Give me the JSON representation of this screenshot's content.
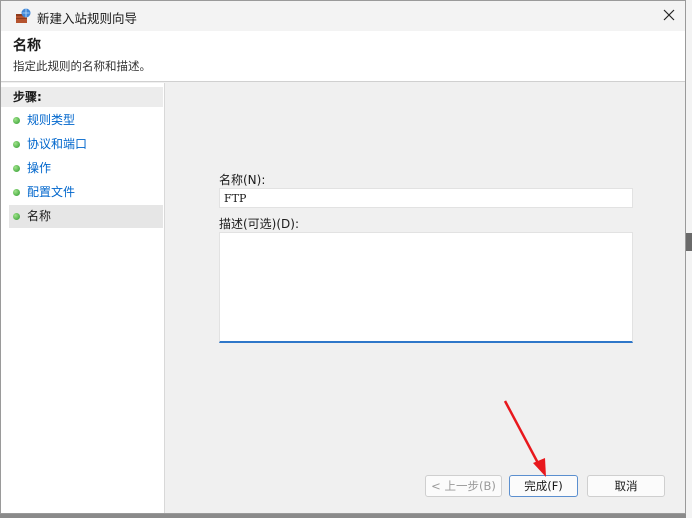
{
  "window": {
    "title": "新建入站规则向导",
    "close_label": "✕"
  },
  "header": {
    "title": "名称",
    "subtitle": "指定此规则的名称和描述。"
  },
  "steps": {
    "title": "步骤:",
    "items": [
      {
        "label": "规则类型"
      },
      {
        "label": "协议和端口"
      },
      {
        "label": "操作"
      },
      {
        "label": "配置文件"
      },
      {
        "label": "名称"
      }
    ]
  },
  "form": {
    "name_label": "名称(N):",
    "name_value": "FTP",
    "desc_label": "描述(可选)(D):",
    "desc_value": ""
  },
  "buttons": {
    "back": "< 上一步(B)",
    "finish": "完成(F)",
    "cancel": "取消"
  },
  "colors": {
    "accent": "#0066cc",
    "annotation_arrow": "#e8181d"
  }
}
